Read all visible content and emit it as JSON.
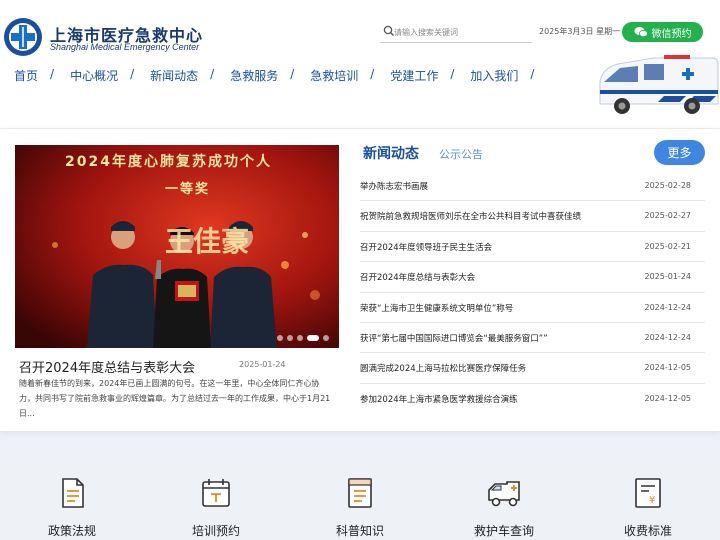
{
  "header": {
    "brand_cn": "上海市医疗急救中心",
    "brand_en": "Shanghai Medical Emergency Center",
    "search_placeholder": "请输入搜索关键词",
    "date": "2025年3月3日 星期一",
    "wechat_label": "微信预约"
  },
  "nav": {
    "items": [
      "首页",
      "中心概况",
      "新闻动态",
      "急救服务",
      "急救培训",
      "党建工作",
      "加入我们"
    ],
    "separator": "/"
  },
  "feature": {
    "photo_banner": "2024年度心肺复苏成功个人",
    "photo_award": "一等奖",
    "photo_bigtext": "王佳豪",
    "title": "召开2024年度总结与表彰大会",
    "date": "2025-01-24",
    "summary": "随着新春佳节的到来，2024年已画上圆满的句号。在这一年里，中心全体同仁齐心协力，共同书写了院前急救事业的辉煌篇章。为了总结过去一年的工作成果，中心于1月21日..."
  },
  "news": {
    "tab_news": "新闻动态",
    "tab_notice": "公示公告",
    "more_label": "更多",
    "items": [
      {
        "title": "举办陈志宏书画展",
        "date": "2025-02-28"
      },
      {
        "title": "祝贺院前急救规培医师刘乐在全市公共科目考试中喜获佳绩",
        "date": "2025-02-27"
      },
      {
        "title": "召开2024年度领导班子民主生活会",
        "date": "2025-02-21"
      },
      {
        "title": "召开2024年度总结与表彰大会",
        "date": "2025-01-24"
      },
      {
        "title": "荣获“上海市卫生健康系统文明单位”称号",
        "date": "2024-12-24"
      },
      {
        "title": "获评“第七届中国国际进口博览会“最美服务窗口””",
        "date": "2024-12-24"
      },
      {
        "title": "圆满完成2024上海马拉松比赛医疗保障任务",
        "date": "2024-12-05"
      },
      {
        "title": "参加2024年上海市紧急医学救援综合演练",
        "date": "2024-12-05"
      }
    ]
  },
  "services": {
    "items": [
      {
        "label": "政策法规",
        "icon": "document-icon"
      },
      {
        "label": "培训预约",
        "icon": "calendar-icon"
      },
      {
        "label": "科普知识",
        "icon": "book-icon"
      },
      {
        "label": "救护车查询",
        "icon": "ambulance-icon"
      },
      {
        "label": "收费标准",
        "icon": "fee-icon"
      }
    ]
  },
  "colors": {
    "primary": "#1a4f9c",
    "accent": "#3f86e0",
    "wechat": "#22b14c"
  }
}
